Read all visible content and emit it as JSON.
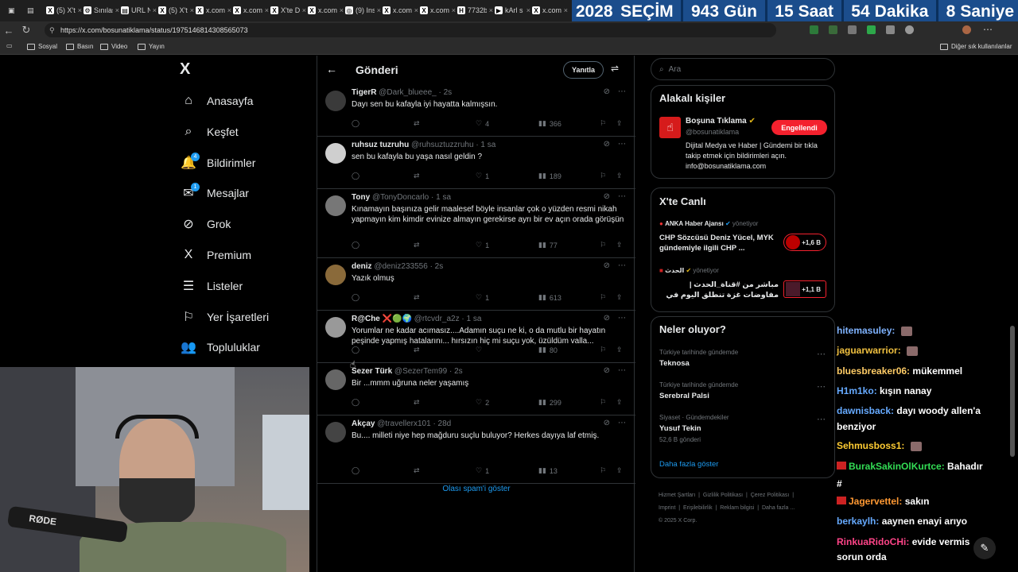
{
  "browser": {
    "tabs": [
      {
        "label": "(5) X'te",
        "icon": "X"
      },
      {
        "label": "Sınılaşt",
        "icon": "⚙"
      },
      {
        "label": "URL N",
        "icon": "▤"
      },
      {
        "label": "(5) X'te",
        "icon": "X"
      },
      {
        "label": "x.com/",
        "icon": "X"
      },
      {
        "label": "x.com/",
        "icon": "X"
      },
      {
        "label": "X'te D",
        "icon": "X"
      },
      {
        "label": "x.com/",
        "icon": "X"
      },
      {
        "label": "(9) Ins",
        "icon": "◎"
      },
      {
        "label": "x.com/",
        "icon": "X"
      },
      {
        "label": "x.com/",
        "icon": "X"
      },
      {
        "label": "7732b",
        "icon": "H"
      },
      {
        "label": "kArl s",
        "icon": "▶"
      },
      {
        "label": "x.com/",
        "icon": "X"
      }
    ],
    "url": "https://x.com/bosunatiklama/status/1975146814308565073",
    "bookmarks": [
      "Sosyal",
      "Basın",
      "Video",
      "Yayın"
    ],
    "other_bookmarks": "Diğer sık kullanılanlar"
  },
  "countdown": {
    "year": "2028",
    "title": "SEÇİM",
    "days": "943",
    "days_label": "Gün",
    "hours": "15",
    "hours_label": "Saat",
    "minutes": "54",
    "minutes_label": "Dakika",
    "seconds": "8",
    "seconds_label": "Saniye"
  },
  "nav": {
    "logo": "X",
    "items": [
      {
        "label": "Anasayfa",
        "icon": "home-icon",
        "glyph": "⌂"
      },
      {
        "label": "Keşfet",
        "icon": "search-icon",
        "glyph": "⌕"
      },
      {
        "label": "Bildirimler",
        "icon": "bell-icon",
        "glyph": "🔔",
        "badge": "4"
      },
      {
        "label": "Mesajlar",
        "icon": "mail-icon",
        "glyph": "✉",
        "badge": "1"
      },
      {
        "label": "Grok",
        "icon": "grok-icon",
        "glyph": "⊘"
      },
      {
        "label": "Premium",
        "icon": "x-premium-icon",
        "glyph": "X"
      },
      {
        "label": "Listeler",
        "icon": "list-icon",
        "glyph": "☰"
      },
      {
        "label": "Yer İşaretleri",
        "icon": "bookmark-icon",
        "glyph": "⚐"
      },
      {
        "label": "Topluluklar",
        "icon": "communities-icon",
        "glyph": "👥"
      }
    ]
  },
  "center": {
    "title": "Gönderi",
    "reply_button": "Yanıtla",
    "spam_link": "Olası spam'i göster",
    "posts": [
      {
        "name": "TigerR",
        "handle": "@Dark_blueee_",
        "time": "· 2s",
        "text": "Dayı sen bu kafayla iyi hayatta kalmışsın.",
        "likes": "4",
        "views": "366",
        "avatar": "#3a3a3a"
      },
      {
        "name": "ruhsuz tuzruhu",
        "handle": "@ruhsuztuzzruhu",
        "time": "· 1 sa",
        "text": "sen bu kafayla bu yaşa nasıl geldin ?",
        "likes": "1",
        "views": "189",
        "avatar": "#cfcfcf"
      },
      {
        "name": "Tony",
        "handle": "@TonyDoncarlo",
        "time": "· 1 sa",
        "text": "Kınamayın başınıza gelir maalesef böyle insanlar çok o yüzden resmi nikah yapmayın kim kimdir evinize almayın gerekirse ayrı bir ev açın orada görüşün",
        "likes": "1",
        "views": "77",
        "avatar": "#777"
      },
      {
        "name": "deniz",
        "handle": "@deniz233556",
        "time": "· 2s",
        "text": "Yazık olmuş",
        "likes": "1",
        "views": "613",
        "avatar": "#8a6a3a"
      },
      {
        "name": "R@Che ❌🟢🌍",
        "handle": "@rtcvdr_a2z",
        "time": "· 1 sa",
        "text": "Yorumlar ne kadar acımasız....Adamın suçu ne ki, o da mutlu bir hayatın peşinde yapmış hatalarını... hırsızın hiç mi suçu yok, üzüldüm valla...",
        "likes": "",
        "views": "80",
        "avatar": "#999"
      },
      {
        "name": "Sezer Türk",
        "handle": "@SezerTem99",
        "time": "· 2s",
        "text": "Bir ...mmm uğruna neler yaşamış",
        "likes": "2",
        "views": "299",
        "avatar": "#666"
      },
      {
        "name": "Akçay",
        "handle": "@travellerx101",
        "time": "· 28d",
        "text": "Bu.... milleti niye hep mağduru suçlu buluyor? Herkes dayıya laf etmiş.",
        "likes": "1",
        "views": "13",
        "avatar": "#444"
      }
    ]
  },
  "right": {
    "search_placeholder": "Ara",
    "related": {
      "title": "Alakalı kişiler",
      "name": "Boşuna Tıklama",
      "handle": "@bosunatiklama",
      "button": "Engellendi",
      "bio": "Dijital Medya ve Haber | Gündemi bir tıkla takip etmek için bildirimleri açın. info@bosunatiklama.com"
    },
    "live": {
      "title": "X'te Canlı",
      "items": [
        {
          "host": "ANKA Haber Ajansı",
          "role": "yönetiyor",
          "text": "CHP Sözcüsü Deniz Yücel, MYK gündemiyle ilgili CHP ...",
          "count": "+1,6 B"
        },
        {
          "host": "الحدث",
          "role": "yönetiyor",
          "text": "مباشر من #قناة_الحدث | مفاوضات غزة تنطلق اليوم في القاهرة.. ولجنة",
          "count": "+1,1 B"
        }
      ]
    },
    "trends": {
      "title": "Neler oluyor?",
      "items": [
        {
          "meta": "Türkiye tarihinde gündemde",
          "name": "Teknosa",
          "posts": ""
        },
        {
          "meta": "Türkiye tarihinde gündemde",
          "name": "Serebral Palsi",
          "posts": ""
        },
        {
          "meta": "Siyaset · Gündemdekiler",
          "name": "Yusuf Tekin",
          "posts": "52,6 B gönderi"
        }
      ],
      "more": "Daha fazla göster"
    },
    "footer": {
      "line1": [
        "Hizmet Şartları",
        "Gizlilik Politikası",
        "Çerez Politikası"
      ],
      "line2": [
        "Imprint",
        "Erişilebilirlik",
        "Reklam bilgisi",
        "Daha fazla ..."
      ],
      "copyright": "© 2025 X Corp."
    }
  },
  "chat": [
    {
      "user": "hitemasuley:",
      "msg": "",
      "color": "#7fb3ff"
    },
    {
      "user": "jaguarwarrior:",
      "msg": "",
      "color": "#f0c040"
    },
    {
      "user": "bluesbreaker06:",
      "msg": "mükemmel",
      "color": "#ffcc66"
    },
    {
      "user": "H1m1ko:",
      "msg": "kışın nanay",
      "color": "#66aaff"
    },
    {
      "user": "dawnisback:",
      "msg": "dayı woody allen'a",
      "color": "#66aaff"
    },
    {
      "user": "",
      "msg": "benziyor",
      "color": "#fff"
    },
    {
      "user": "Sehmusboss1:",
      "msg": "",
      "color": "#ffcc33"
    },
    {
      "user": "BurakSakinOlKurtce:",
      "msg": "Bahadır",
      "color": "#33dd55"
    },
    {
      "user": "",
      "msg": "#",
      "color": "#fff"
    },
    {
      "user": "Jagervettel:",
      "msg": "sakın",
      "color": "#ff9933"
    },
    {
      "user": "berkaylh:",
      "msg": "aaynen enayi arıyo",
      "color": "#66aaff"
    },
    {
      "user": "RinkuaRidoCHi:",
      "msg": "evide vermis",
      "color": "#ff4488"
    },
    {
      "user": "",
      "msg": "sorun orda",
      "color": "#fff"
    }
  ],
  "colors": {
    "accent": "#1d9bf0",
    "blocked": "#f4212e",
    "countdown_bg": "#1b4d8c"
  }
}
